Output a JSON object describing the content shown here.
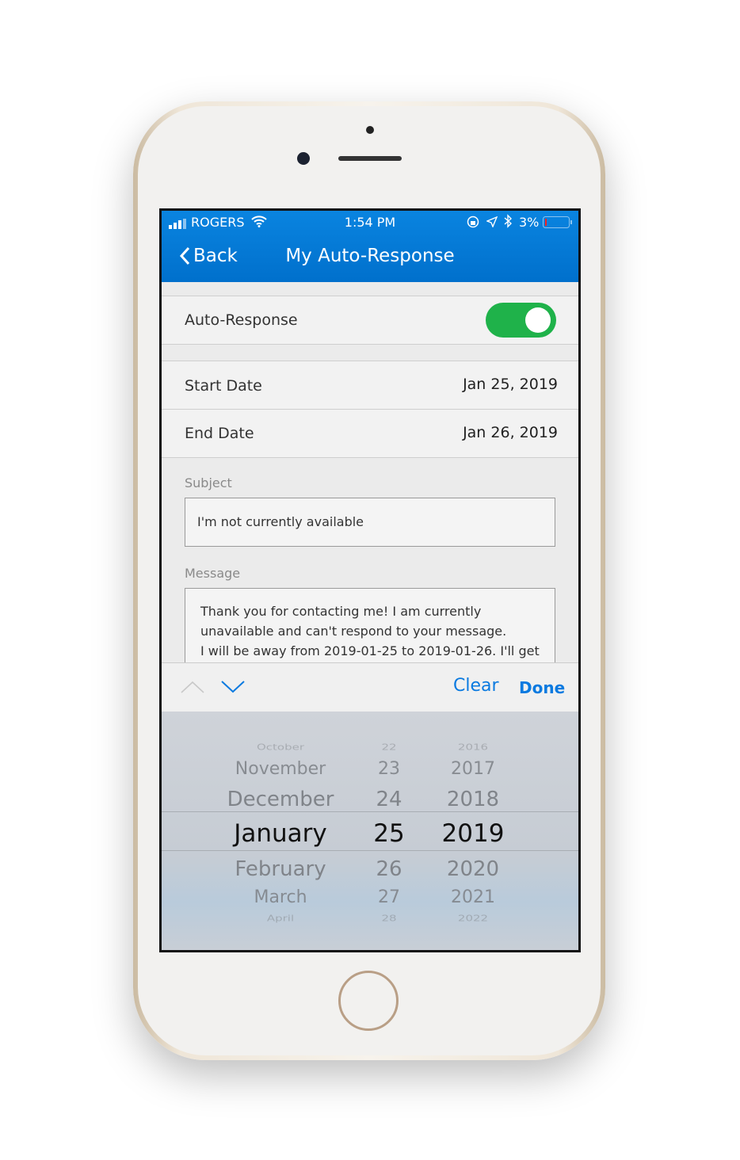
{
  "status_bar": {
    "carrier": "ROGERS",
    "time": "1:54 PM",
    "battery": "3%",
    "icons": [
      "signal-icon",
      "wifi-icon",
      "rotation-lock-icon",
      "location-icon",
      "bluetooth-icon",
      "battery-icon"
    ]
  },
  "nav": {
    "back_label": "Back",
    "title": "My Auto-Response"
  },
  "auto_response": {
    "label": "Auto-Response",
    "enabled": true
  },
  "start_date": {
    "label": "Start Date",
    "value": "Jan 25, 2019"
  },
  "end_date": {
    "label": "End Date",
    "value": "Jan 26, 2019"
  },
  "subject": {
    "label": "Subject",
    "value": "I'm not currently available"
  },
  "message": {
    "label": "Message",
    "lines": [
      "Thank you for contacting me! I am currently",
      "unavailable and can't respond to your message.",
      "I will be away from 2019-01-25 to 2019-01-26. I'll get"
    ]
  },
  "toolbar": {
    "clear_label": "Clear",
    "done_label": "Done"
  },
  "picker": {
    "months": [
      "October",
      "November",
      "December",
      "January",
      "February",
      "March",
      "April"
    ],
    "days": [
      "22",
      "23",
      "24",
      "25",
      "26",
      "27",
      "28"
    ],
    "years": [
      "2016",
      "2017",
      "2018",
      "2019",
      "2020",
      "2021",
      "2022"
    ],
    "selected": {
      "month": "January",
      "day": "25",
      "year": "2019"
    }
  },
  "colors": {
    "nav": "#0a7ed8",
    "toggle_on": "#1fb24a",
    "accent": "#0a7ae0"
  }
}
